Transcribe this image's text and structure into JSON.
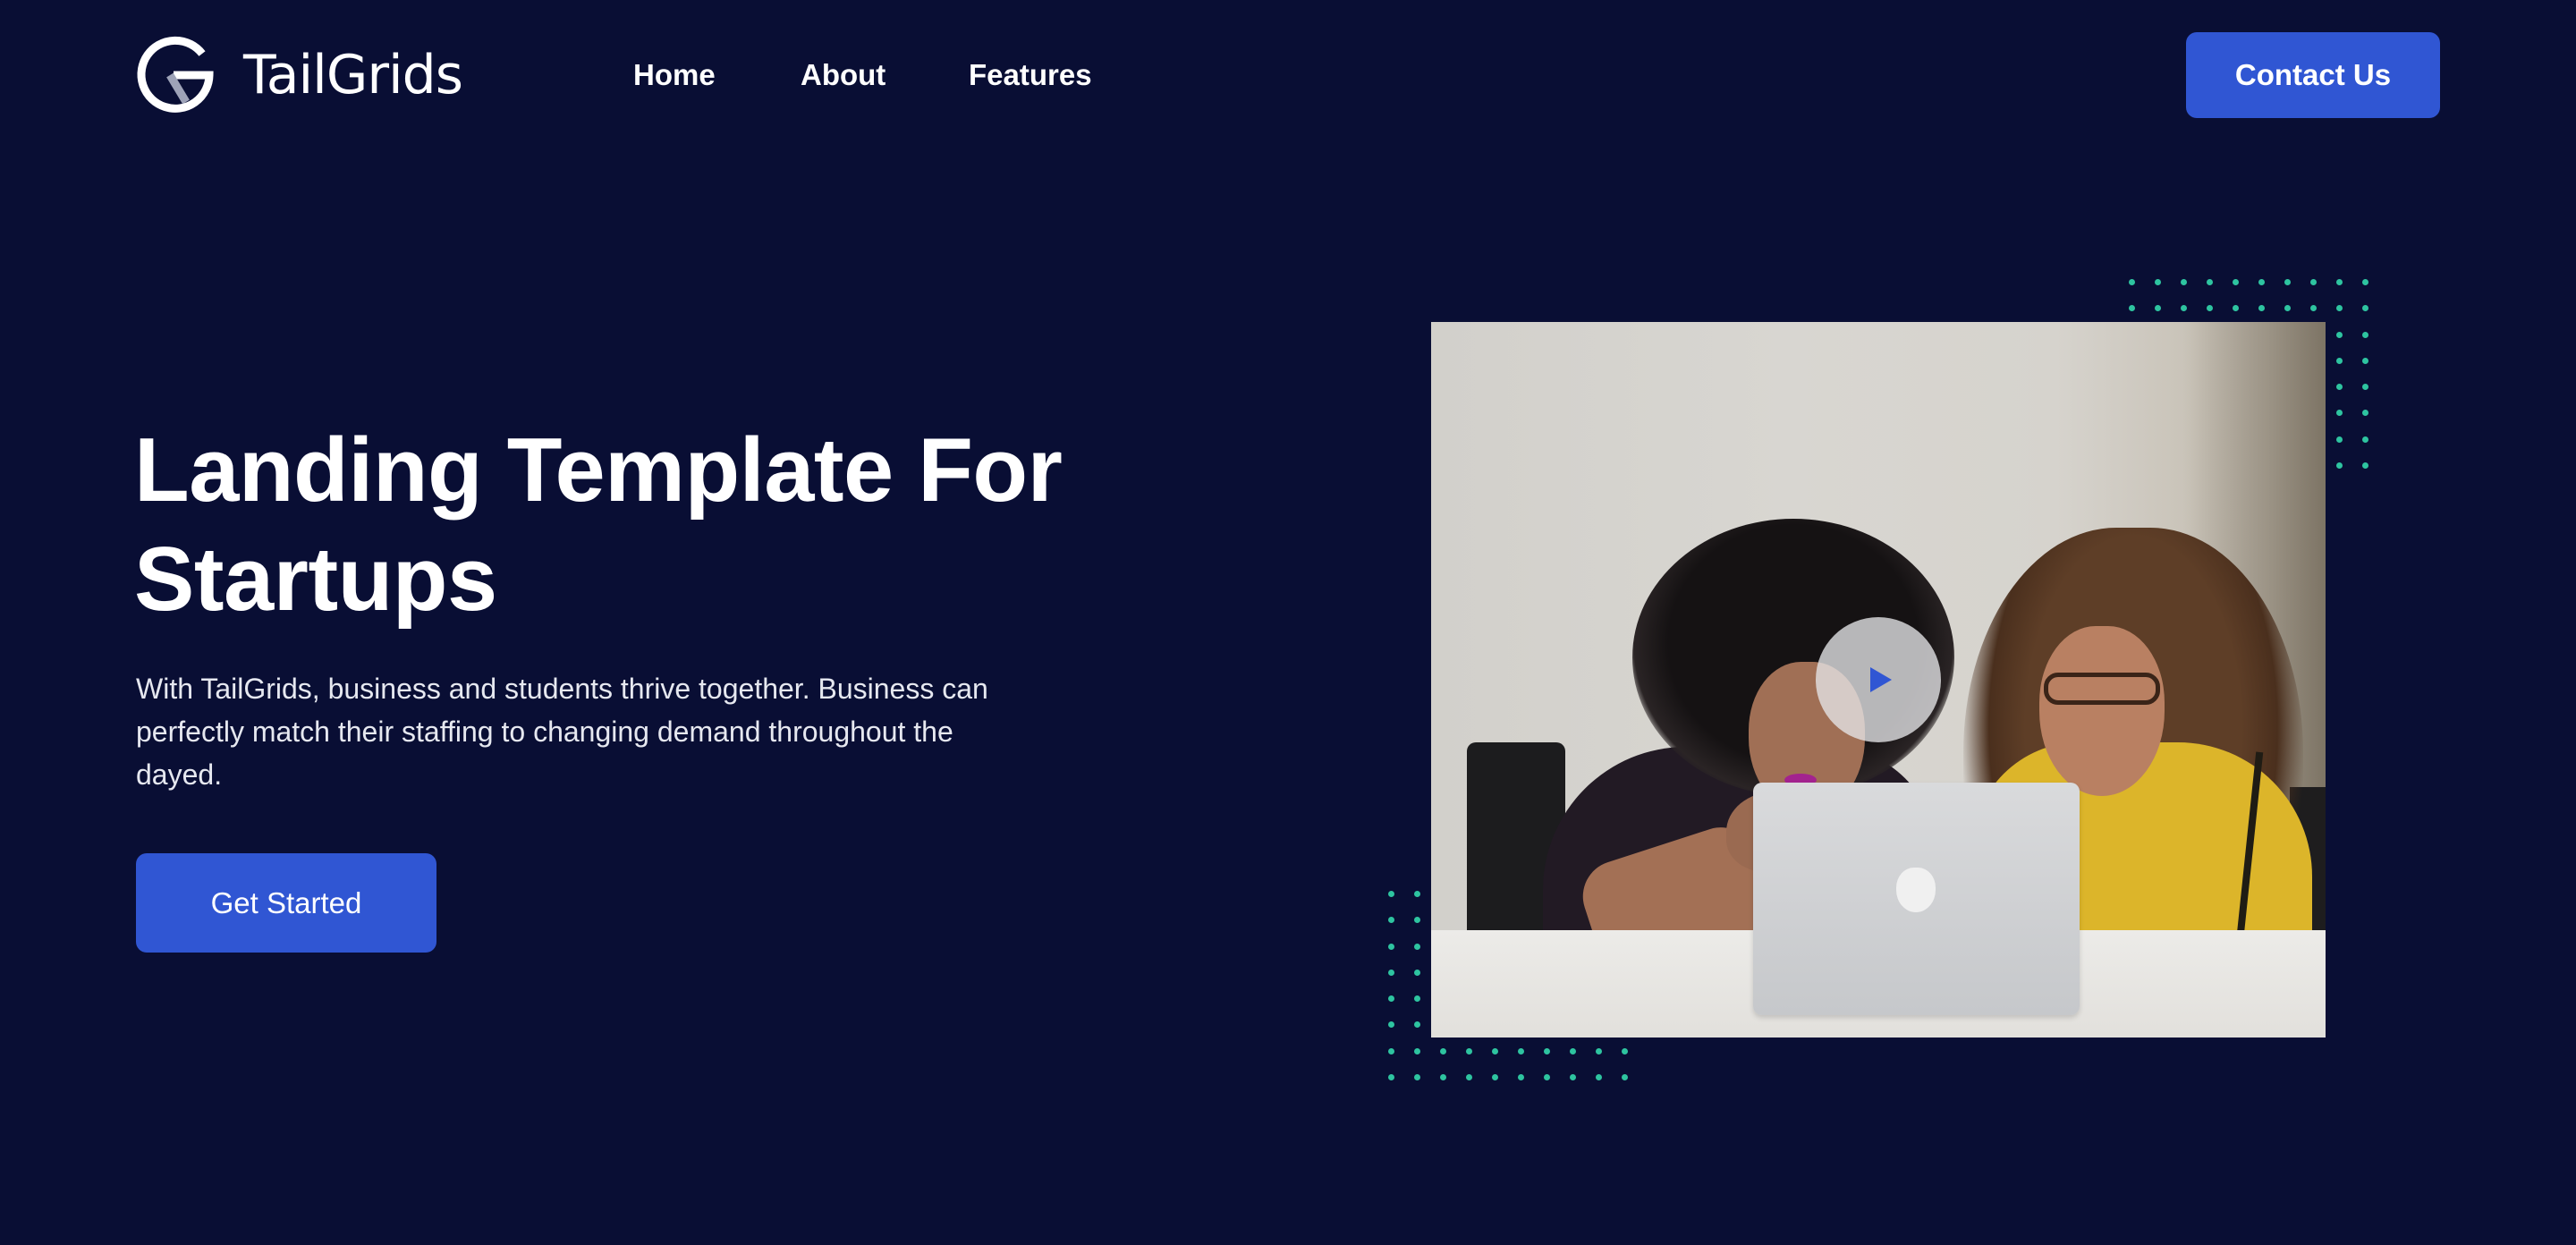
{
  "header": {
    "logo": {
      "icon": "tailgrids-g-logo-icon",
      "text": "TailGrids"
    },
    "nav": [
      {
        "label": "Home"
      },
      {
        "label": "About"
      },
      {
        "label": "Features"
      }
    ],
    "contact_button": "Contact Us"
  },
  "hero": {
    "title": "Landing Template For Startups",
    "description": "With TailGrids, business and students thrive together. Business can perfectly match their staffing to changing demand throughout the dayed.",
    "cta_button": "Get Started",
    "image": {
      "alt": "Two women looking at a laptop",
      "play_icon": "play-icon"
    }
  },
  "colors": {
    "background": "#090E34",
    "primary": "#3056D3",
    "dots": "#2EC4A0",
    "text": "#FFFFFF"
  }
}
